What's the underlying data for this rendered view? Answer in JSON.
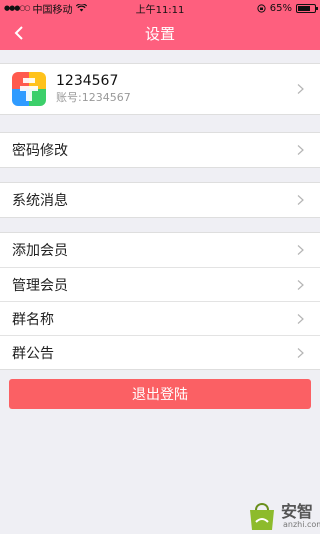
{
  "status_bar": {
    "carrier": "中国移动",
    "time": "上午11:11",
    "battery": "65%",
    "battery_level": 0.65
  },
  "nav": {
    "title": "设置",
    "back_icon": "chevron-left-icon"
  },
  "profile": {
    "name": "1234567",
    "account": "账号:1234567"
  },
  "menu": {
    "password": "密码修改",
    "messages": "系统消息",
    "add_member": "添加会员",
    "manage_member": "管理会员",
    "group_name": "群名称",
    "group_notice": "群公告"
  },
  "logout_label": "退出登陆",
  "watermark": {
    "brand": "安智",
    "domain": "anzhi.com"
  },
  "colors": {
    "accent": "#fe5f7e",
    "logout": "#fb6064",
    "background": "#efeff4"
  }
}
